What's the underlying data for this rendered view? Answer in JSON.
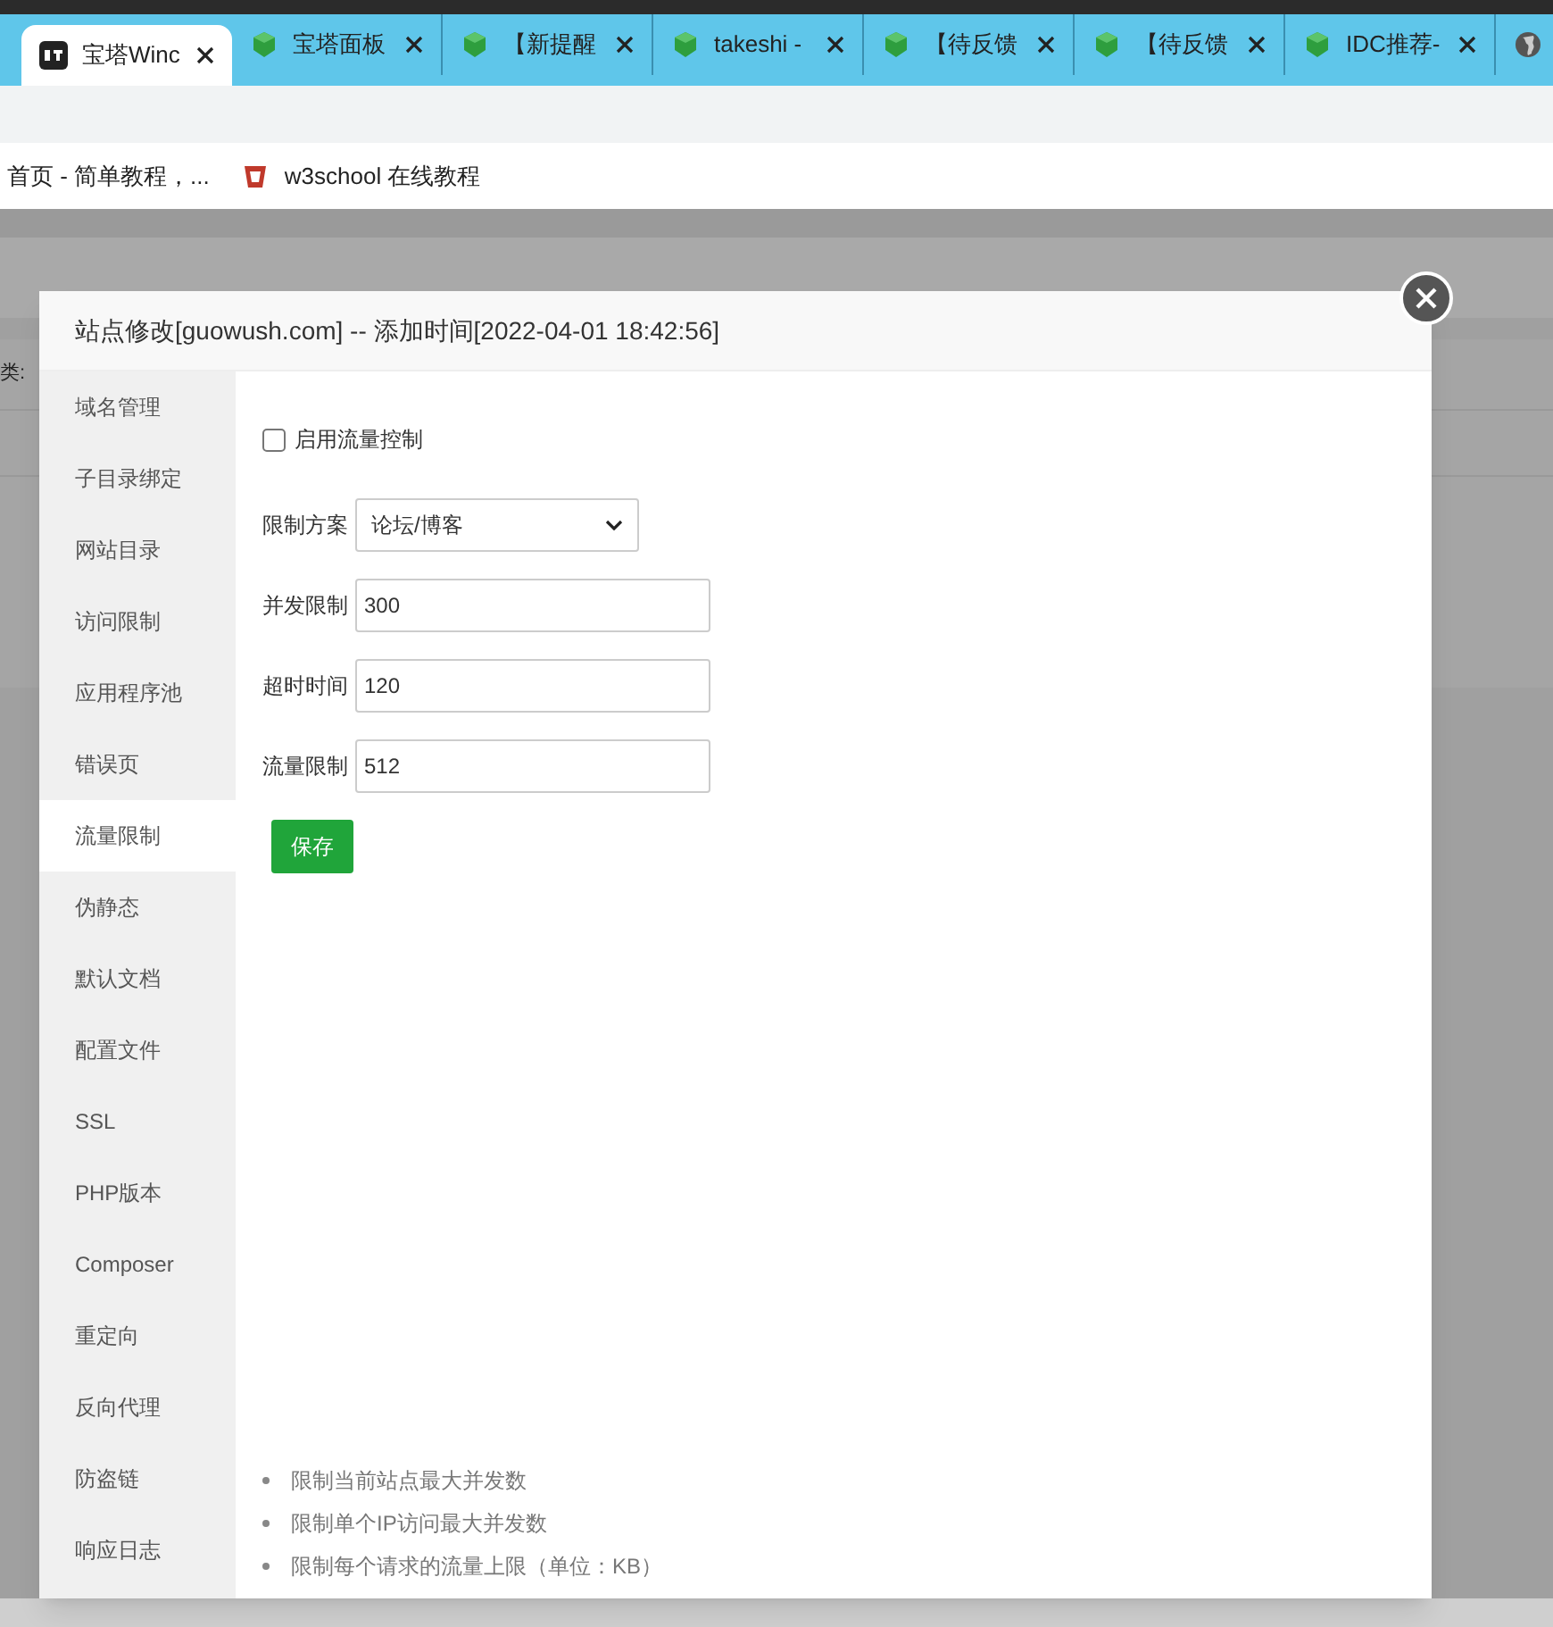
{
  "browser": {
    "tabs": [
      {
        "label": "宝塔Winc",
        "selected": true,
        "kind": "bt"
      },
      {
        "label": "宝塔面板",
        "selected": false,
        "kind": "shield"
      },
      {
        "label": "【新提醒",
        "selected": false,
        "kind": "shield"
      },
      {
        "label": "takeshi -",
        "selected": false,
        "kind": "shield"
      },
      {
        "label": "【待反馈",
        "selected": false,
        "kind": "shield"
      },
      {
        "label": "【待反馈",
        "selected": false,
        "kind": "shield"
      },
      {
        "label": "IDC推荐-",
        "selected": false,
        "kind": "shield"
      },
      {
        "selected": false,
        "kind": "globe"
      }
    ],
    "bookmarks": [
      {
        "label": "首页 - 简单教程，...",
        "kind": "plain"
      },
      {
        "label": "w3school 在线教程",
        "kind": "w3"
      }
    ]
  },
  "background_page": {
    "filter_label": "类:"
  },
  "dialog": {
    "title": "站点修改[guowush.com] -- 添加时间[2022-04-01 18:42:56]",
    "menu": [
      {
        "label": "域名管理",
        "selected": false
      },
      {
        "label": "子目录绑定",
        "selected": false
      },
      {
        "label": "网站目录",
        "selected": false
      },
      {
        "label": "访问限制",
        "selected": false
      },
      {
        "label": "应用程序池",
        "selected": false
      },
      {
        "label": "错误页",
        "selected": false
      },
      {
        "label": "流量限制",
        "selected": true
      },
      {
        "label": "伪静态",
        "selected": false
      },
      {
        "label": "默认文档",
        "selected": false
      },
      {
        "label": "配置文件",
        "selected": false
      },
      {
        "label": "SSL",
        "selected": false
      },
      {
        "label": "PHP版本",
        "selected": false
      },
      {
        "label": "Composer",
        "selected": false
      },
      {
        "label": "重定向",
        "selected": false
      },
      {
        "label": "反向代理",
        "selected": false
      },
      {
        "label": "防盗链",
        "selected": false
      },
      {
        "label": "响应日志",
        "selected": false
      }
    ],
    "enable": {
      "label": "启用流量控制",
      "checked": false
    },
    "scheme": {
      "label": "限制方案",
      "value": "论坛/博客"
    },
    "fields": [
      {
        "label": "并发限制",
        "value": "300"
      },
      {
        "label": "超时时间",
        "value": "120"
      },
      {
        "label": "流量限制",
        "value": "512"
      }
    ],
    "save_button": "保存",
    "notes": [
      "限制当前站点最大并发数",
      "限制单个IP访问最大并发数",
      "限制每个请求的流量上限（单位：KB）"
    ]
  }
}
